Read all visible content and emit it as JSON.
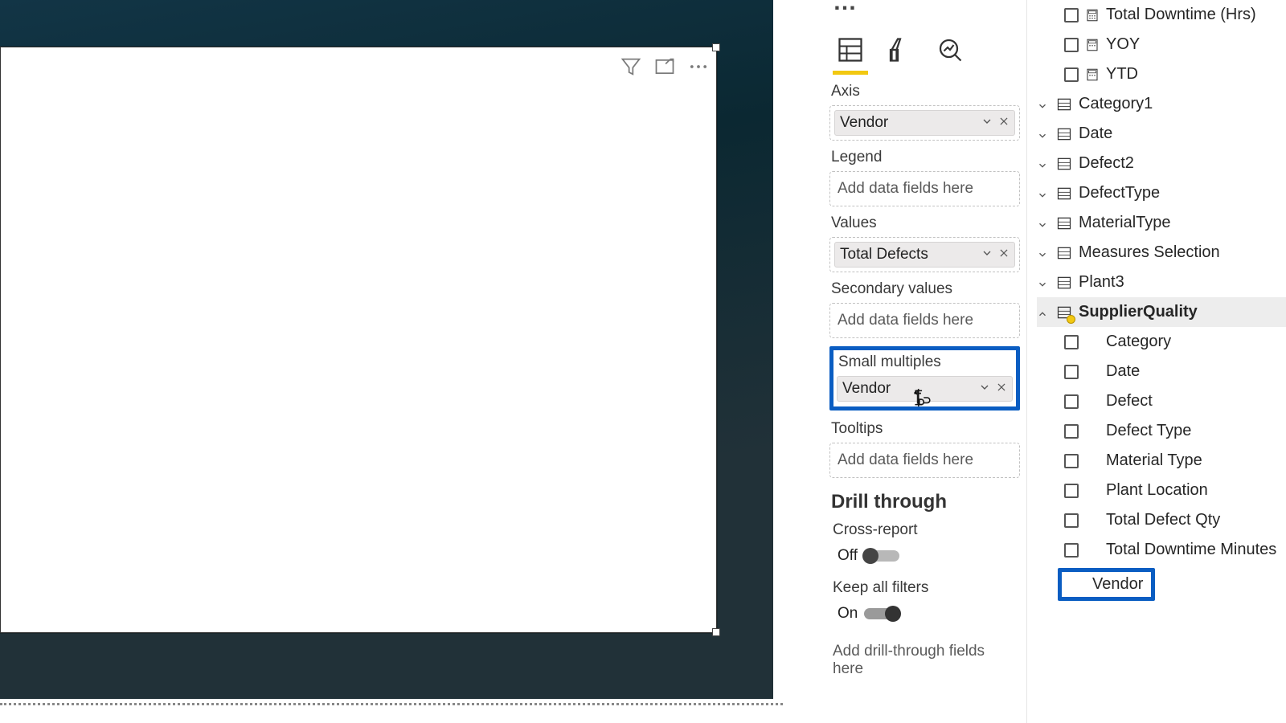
{
  "viz": {
    "axis_label": "Axis",
    "axis_chip": "Vendor",
    "legend_label": "Legend",
    "legend_placeholder": "Add data fields here",
    "values_label": "Values",
    "values_chip": "Total Defects",
    "secondary_label": "Secondary values",
    "secondary_placeholder": "Add data fields here",
    "smallmult_label": "Small multiples",
    "smallmult_chip": "Vendor",
    "tooltips_label": "Tooltips",
    "tooltips_placeholder": "Add data fields here",
    "drill_heading": "Drill through",
    "cross_report_label": "Cross-report",
    "cross_report_state": "Off",
    "keep_filters_label": "Keep all filters",
    "keep_filters_state": "On",
    "drill_placeholder": "Add drill-through fields here"
  },
  "fields": {
    "measures": [
      "Total Downtime (Hrs)",
      "YOY",
      "YTD"
    ],
    "tables": [
      "Category1",
      "Date",
      "Defect2",
      "DefectType",
      "MaterialType",
      "Measures Selection",
      "Plant3"
    ],
    "expanded_table": "SupplierQuality",
    "expanded_cols": [
      "Category",
      "Date",
      "Defect",
      "Defect Type",
      "Material Type",
      "Plant Location",
      "Total Defect Qty",
      "Total Downtime Minutes"
    ],
    "checked_col": "Vendor"
  }
}
